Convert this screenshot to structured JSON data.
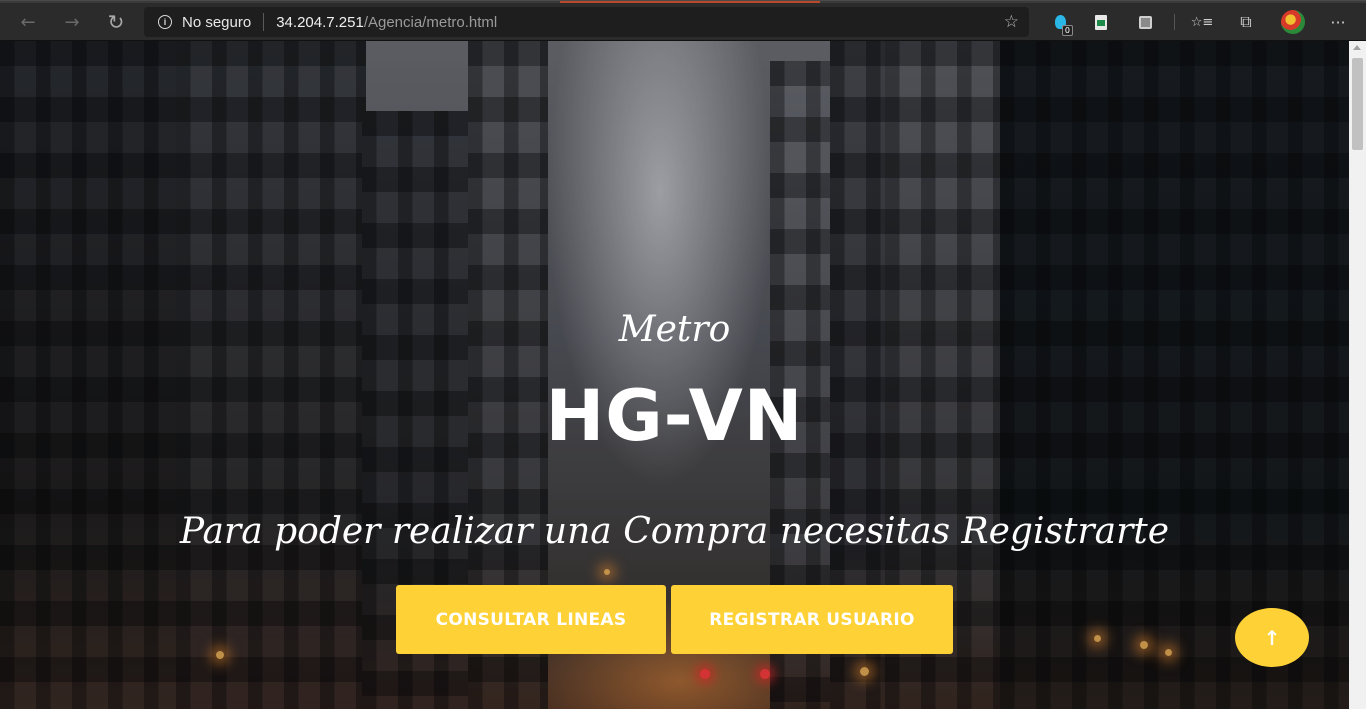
{
  "browser": {
    "back_icon": "←",
    "forward_icon": "→",
    "reload_icon": "↻",
    "security_label": "No seguro",
    "url_host": "34.204.7.251",
    "url_path": "/Agencia/metro.html",
    "favorite_icon": "☆",
    "extension_badge": "0",
    "favorites_bar_icon": "☆≡",
    "collections_icon": "⧉",
    "more_icon": "···"
  },
  "hero": {
    "subheading": "Metro",
    "heading": "HG-VN",
    "tagline": "Para poder realizar una Compra necesitas Registrarte",
    "buttons": {
      "consult_lines": "CONSULTAR LINEAS",
      "register_user": "REGISTRAR USUARIO"
    },
    "scroll_top_icon": "↑"
  },
  "colors": {
    "accent": "#fed136",
    "text": "#ffffff",
    "chrome_bg": "#2b2b2b"
  }
}
